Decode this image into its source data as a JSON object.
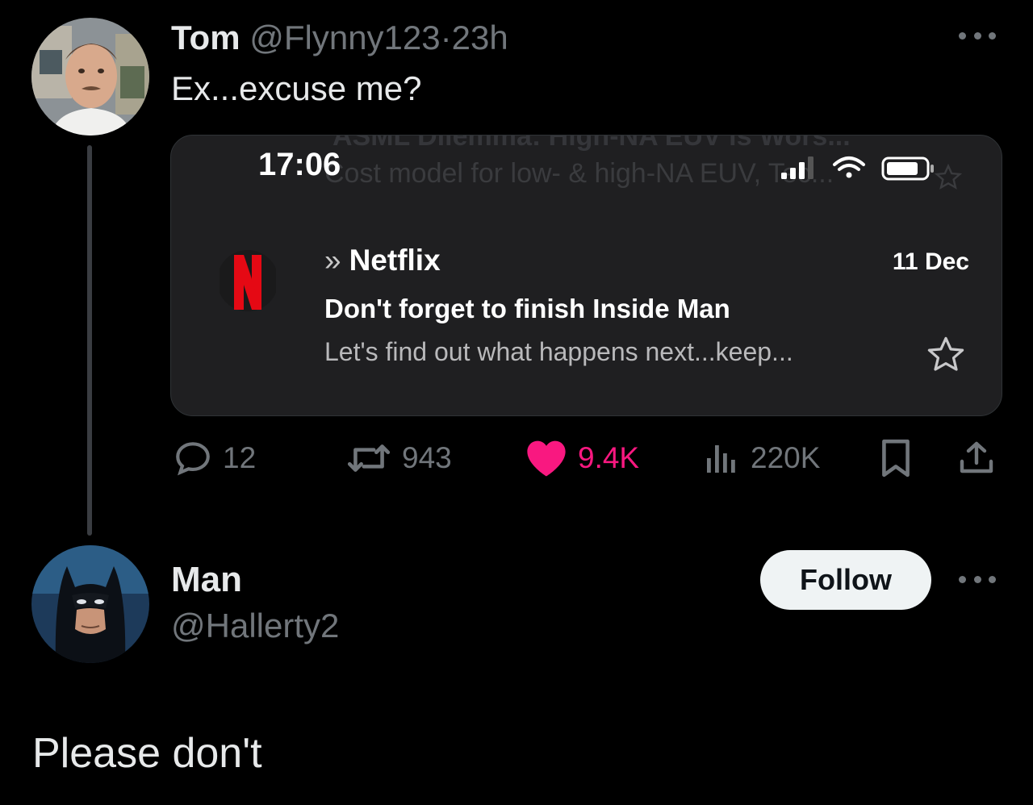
{
  "tweet": {
    "author_name": "Tom",
    "author_handle": "@Flynny123",
    "separator": "·",
    "time": "23h",
    "text": "Ex...excuse me?",
    "embedded_screenshot": {
      "ghost_top_text": "ASML Dilemma: High-NA EUV is Wors...",
      "ghost_line": "Cost model for low- & high-NA EUV, Tec...",
      "status_time": "17:06",
      "mail": {
        "sender": "Netflix",
        "date": "11 Dec",
        "subject": "Don't forget to finish Inside Man",
        "preview": "Let's find out what happens next...keep..."
      }
    },
    "actions": {
      "replies": "12",
      "reposts": "943",
      "likes": "9.4K",
      "views": "220K"
    }
  },
  "reply": {
    "author_name": "Man",
    "author_handle": "@Hallerty2",
    "follow_label": "Follow",
    "text": "Please don't"
  },
  "colors": {
    "background": "#000000",
    "primary_text": "#e7e9ea",
    "secondary_text": "#71767b",
    "like": "#f91880",
    "netflix_red": "#e50914"
  },
  "icons": [
    "more-icon",
    "reply-icon",
    "repost-icon",
    "heart-icon",
    "views-icon",
    "bookmark-icon",
    "share-icon",
    "star-icon",
    "signal-icon",
    "wifi-icon",
    "battery-icon",
    "netflix-logo"
  ]
}
